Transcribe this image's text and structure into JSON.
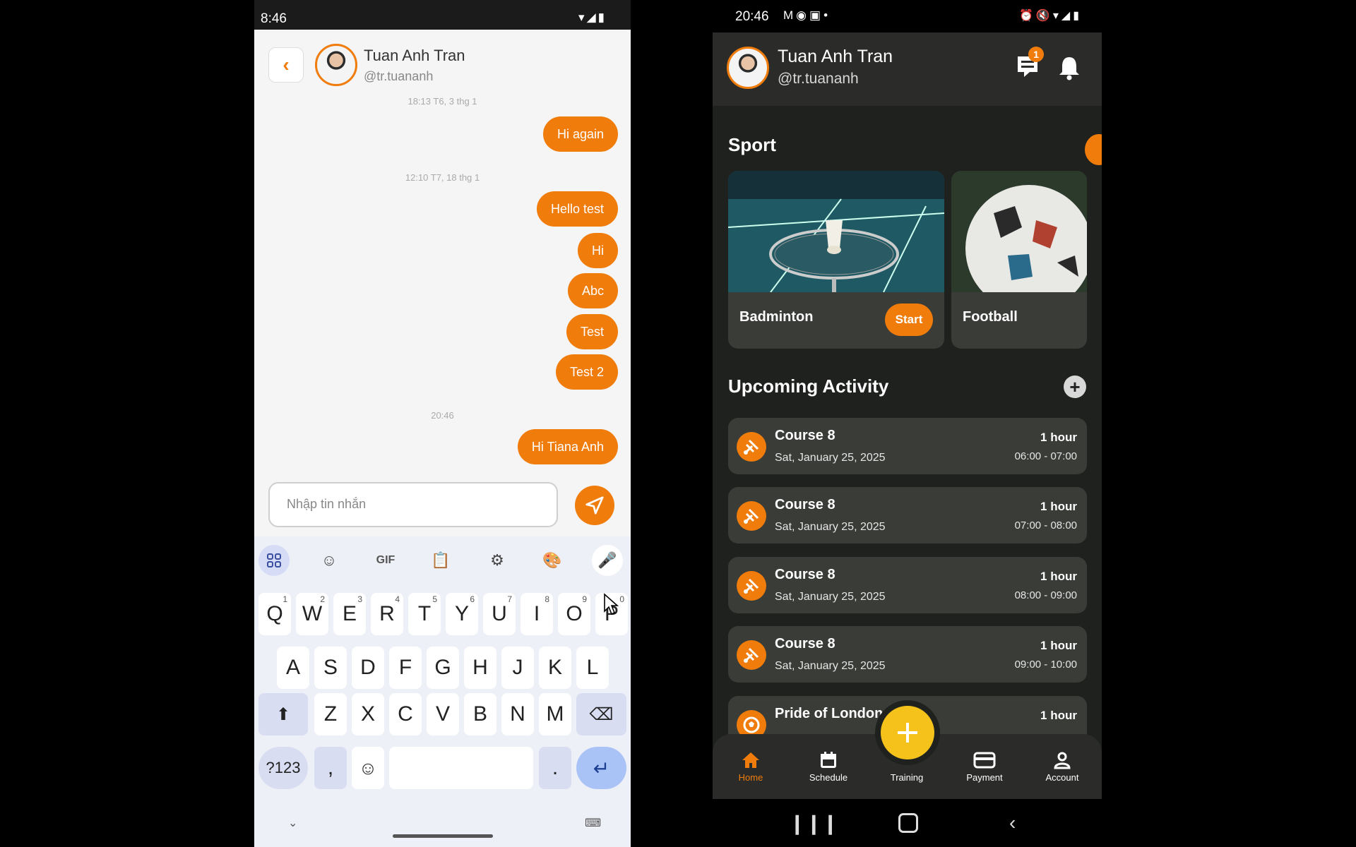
{
  "left": {
    "status": {
      "time": "8:46"
    },
    "header": {
      "name": "Tuan Anh Tran",
      "handle": "@tr.tuananh"
    },
    "messages": [
      {
        "type": "ts",
        "text": "18:13 T6, 3 thg 1"
      },
      {
        "type": "msg",
        "text": "Hi again"
      },
      {
        "type": "ts",
        "text": "12:10 T7, 18 thg 1"
      },
      {
        "type": "msg",
        "text": "Hello test"
      },
      {
        "type": "msg",
        "text": "Hi"
      },
      {
        "type": "msg",
        "text": "Abc"
      },
      {
        "type": "msg",
        "text": "Test"
      },
      {
        "type": "msg",
        "text": "Test 2"
      },
      {
        "type": "ts",
        "text": "20:46"
      },
      {
        "type": "msg",
        "text": "Hi Tiana Anh"
      }
    ],
    "input": {
      "placeholder": "Nhập tin nhắn",
      "value": ""
    },
    "keyboard": {
      "gif": "GIF",
      "row1": [
        "Q",
        "W",
        "E",
        "R",
        "T",
        "Y",
        "U",
        "I",
        "O",
        "P"
      ],
      "row1_nums": [
        "1",
        "2",
        "3",
        "4",
        "5",
        "6",
        "7",
        "8",
        "9",
        "0"
      ],
      "row2": [
        "A",
        "S",
        "D",
        "F",
        "G",
        "H",
        "J",
        "K",
        "L"
      ],
      "row3": [
        "Z",
        "X",
        "C",
        "V",
        "B",
        "N",
        "M"
      ],
      "symbols": "?123",
      "comma": ",",
      "period": "."
    }
  },
  "right": {
    "status": {
      "time": "20:46"
    },
    "header": {
      "name": "Tuan Anh Tran",
      "handle": "@tr.tuananh",
      "badge": "1"
    },
    "sport": {
      "title": "Sport",
      "cards": [
        {
          "label": "Badminton",
          "button": "Start"
        },
        {
          "label": "Football"
        }
      ]
    },
    "upcoming": {
      "title": "Upcoming Activity",
      "items": [
        {
          "title": "Course 8",
          "date": "Sat, January 25, 2025",
          "duration": "1 hour",
          "time": "06:00 - 07:00"
        },
        {
          "title": "Course 8",
          "date": "Sat, January 25, 2025",
          "duration": "1 hour",
          "time": "07:00 - 08:00"
        },
        {
          "title": "Course 8",
          "date": "Sat, January 25, 2025",
          "duration": "1 hour",
          "time": "08:00 - 09:00"
        },
        {
          "title": "Course 8",
          "date": "Sat, January 25, 2025",
          "duration": "1 hour",
          "time": "09:00 - 10:00"
        },
        {
          "title": "Pride of London",
          "date": "",
          "duration": "1 hour",
          "time": ""
        }
      ]
    },
    "nav": [
      "Home",
      "Schedule",
      "Training",
      "Payment",
      "Account"
    ],
    "colors": {
      "accent": "#f07c0c",
      "fab": "#f4c21b",
      "bg": "#1f211e",
      "card": "#3a3c38"
    }
  }
}
